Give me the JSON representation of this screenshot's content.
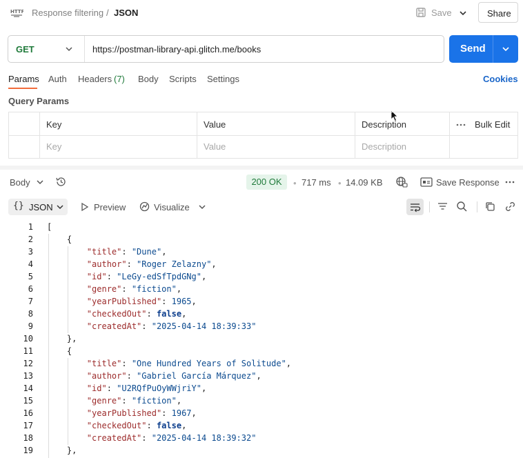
{
  "header": {
    "collection_name": "Response filtering",
    "separator": "/",
    "request_name": "JSON",
    "save_label": "Save",
    "share_label": "Share",
    "method_badge_icon": "http-icon"
  },
  "request": {
    "method": "GET",
    "url": "https://postman-library-api.glitch.me/books",
    "send_label": "Send"
  },
  "tabs": {
    "params": "Params",
    "auth": "Auth",
    "headers": "Headers",
    "headers_count": "(7)",
    "body": "Body",
    "scripts": "Scripts",
    "settings": "Settings",
    "cookies": "Cookies"
  },
  "query_params": {
    "title": "Query Params",
    "columns": {
      "key": "Key",
      "value": "Value",
      "description": "Description",
      "bulk_edit": "Bulk Edit"
    },
    "placeholders": {
      "key": "Key",
      "value": "Value",
      "description": "Description"
    }
  },
  "response": {
    "body_label": "Body",
    "status": "200 OK",
    "time": "717 ms",
    "size": "14.09 KB",
    "save_response_label": "Save Response",
    "format_label": "JSON",
    "preview_label": "Preview",
    "visualize_label": "Visualize"
  },
  "colors": {
    "accent_blue": "#1a73e8",
    "tab_underline": "#f26b3a",
    "status_ok_bg": "#e5f4ea",
    "status_ok_text": "#1f7a3a"
  },
  "code": {
    "line_numbers": [
      "1",
      "2",
      "3",
      "4",
      "5",
      "6",
      "7",
      "8",
      "9",
      "10",
      "11",
      "12",
      "13",
      "14",
      "15",
      "16",
      "17",
      "18",
      "19"
    ],
    "open_array": "[",
    "books": [
      {
        "title": "\"Dune\"",
        "author": "\"Roger Zelazny\"",
        "id": "\"LeGy-edSfTpdGNg\"",
        "genre": "\"fiction\"",
        "yearPublished": "1965",
        "checkedOut": "false",
        "createdAt": "\"2025-04-14 18:39:33\""
      },
      {
        "title": "\"One Hundred Years of Solitude\"",
        "author": "\"Gabriel García Márquez\"",
        "id": "\"U2RQfPuOyWWjriY\"",
        "genre": "\"fiction\"",
        "yearPublished": "1967",
        "checkedOut": "false",
        "createdAt": "\"2025-04-14 18:39:32\""
      }
    ],
    "keys": {
      "title": "\"title\"",
      "author": "\"author\"",
      "id": "\"id\"",
      "genre": "\"genre\"",
      "yearPublished": "\"yearPublished\"",
      "checkedOut": "\"checkedOut\"",
      "createdAt": "\"createdAt\""
    }
  }
}
